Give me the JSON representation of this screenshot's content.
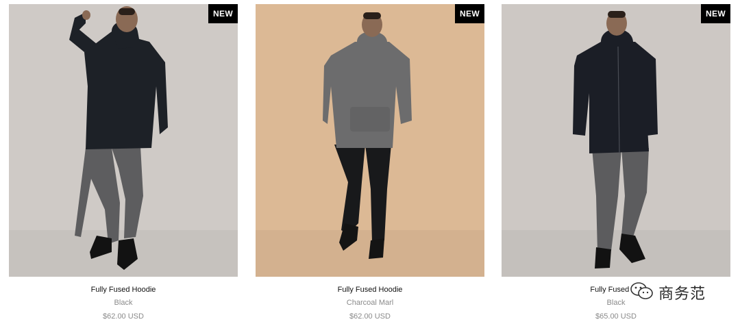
{
  "products": [
    {
      "badge": "NEW",
      "name": "Fully Fused Hoodie",
      "color": "Black",
      "price": "$62.00 USD",
      "background": "#cfcac6",
      "top_color": "#1d2127",
      "bottom_color": "#5d5d5f"
    },
    {
      "badge": "NEW",
      "name": "Fully Fused Hoodie",
      "color": "Charcoal Marl",
      "price": "$62.00 USD",
      "background": "#dcb995",
      "top_color": "#6c6c6d",
      "bottom_color": "#18191b"
    },
    {
      "badge": "NEW",
      "name": "Fully Fused Zip",
      "color": "Black",
      "price": "$65.00 USD",
      "background": "#cdc8c4",
      "top_color": "#1b1e26",
      "bottom_color": "#5c5c5e"
    }
  ],
  "watermark": {
    "text": "商务范",
    "icon": "wechat-icon"
  }
}
